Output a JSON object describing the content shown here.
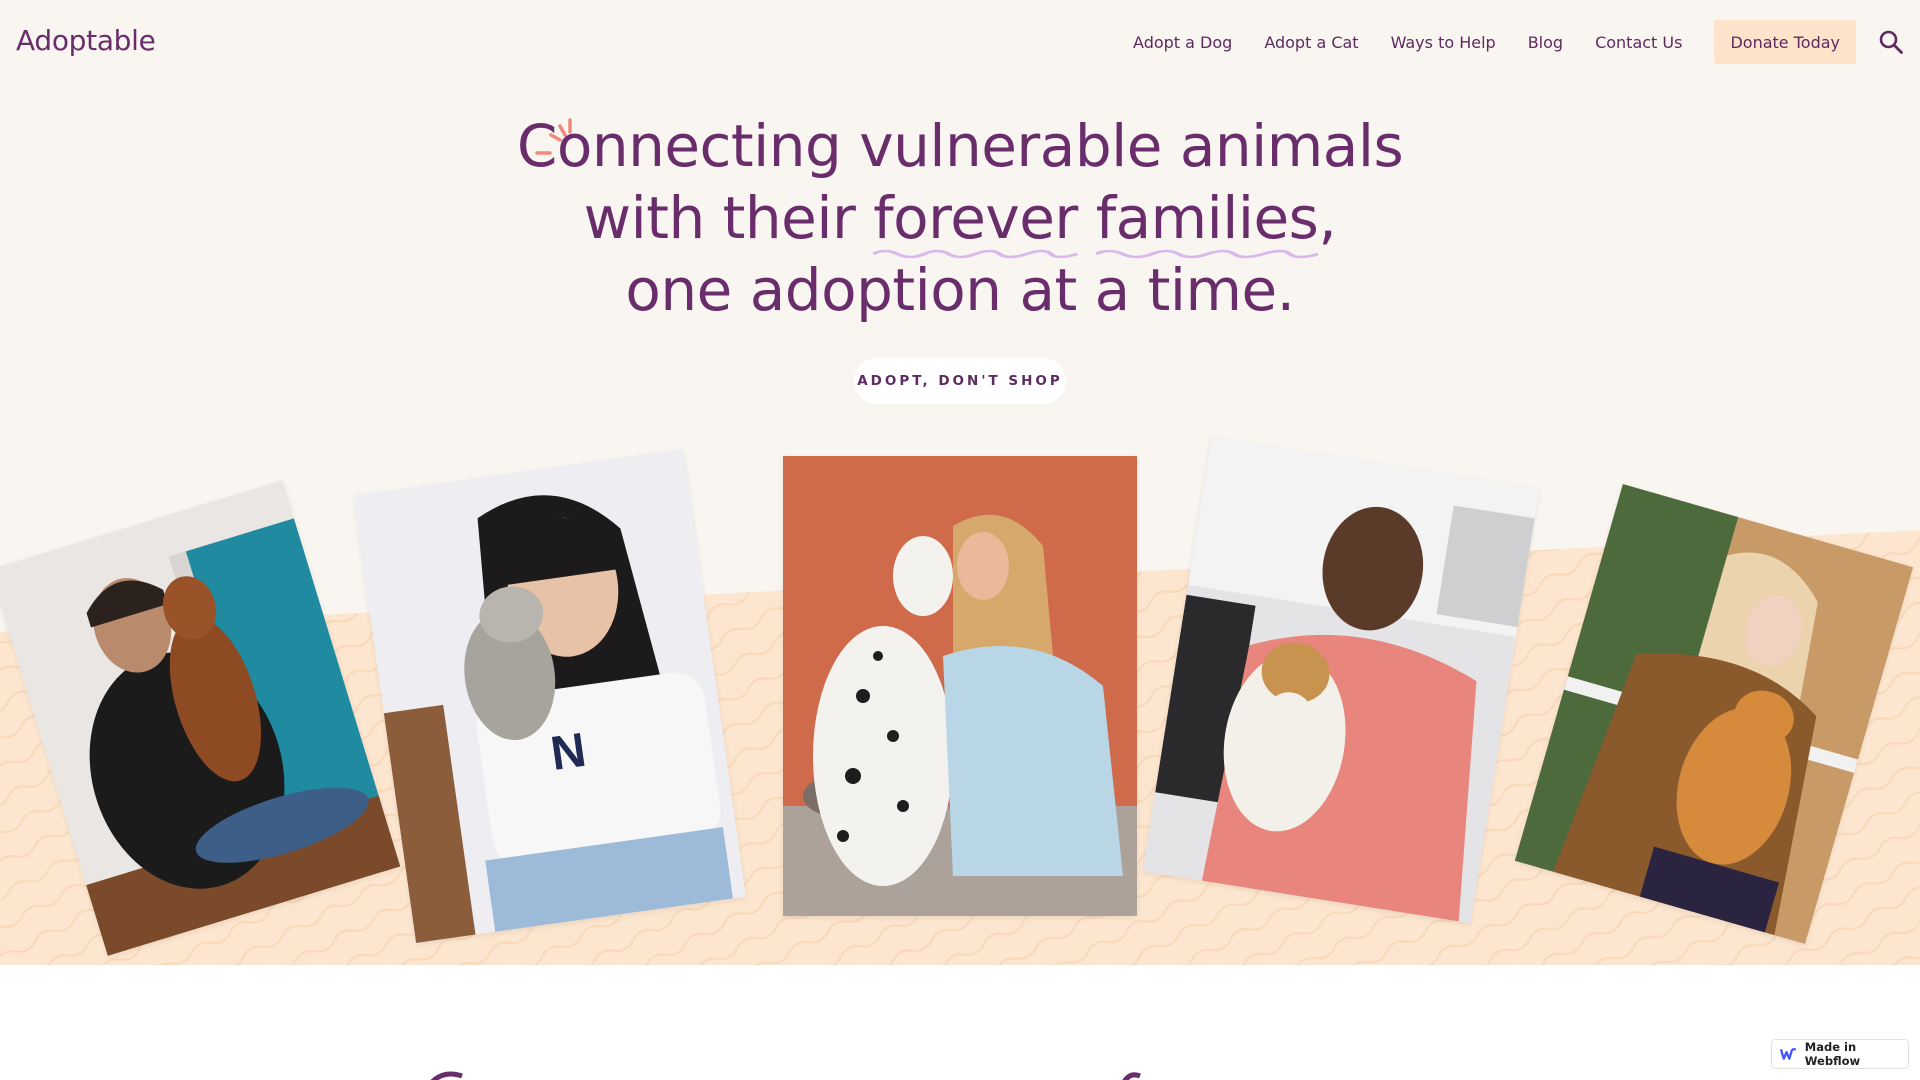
{
  "header": {
    "logo": "Adoptable",
    "nav": [
      "Adopt a Dog",
      "Adopt a Cat",
      "Ways to Help",
      "Blog",
      "Contact Us"
    ],
    "donate_label": "Donate Today",
    "search_icon": "search-icon"
  },
  "hero": {
    "line1": "Connecting vulnerable animals",
    "line2_pre": "with their ",
    "line2_word1": "forever",
    "line2_word2": "families",
    "line2_post": ",",
    "line3": "one adoption at a time.",
    "tag": "ADOPT, DON'T SHOP"
  },
  "colors": {
    "primary": "#6a2d6b",
    "background": "#f9f5f1",
    "band": "#fde6cf",
    "donate_bg": "#fde3c9",
    "accent": "#ef8a7a",
    "squiggle": "#d9b7ea"
  },
  "photos": [
    {
      "subject": "man-hugging-dachshund"
    },
    {
      "subject": "woman-kissing-kitten"
    },
    {
      "subject": "woman-with-dalmatian"
    },
    {
      "subject": "man-holding-terrier"
    },
    {
      "subject": "woman-holding-orange-cat"
    }
  ],
  "badge": {
    "label": "Made in Webflow"
  }
}
